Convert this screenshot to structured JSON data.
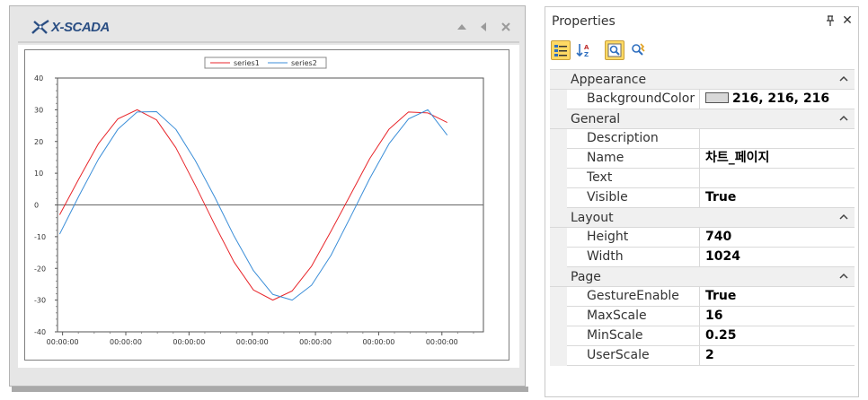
{
  "panel": {
    "logo_text": "X-SCADA",
    "controls": [
      "up-arrow-icon",
      "left-arrow-icon",
      "close-icon"
    ]
  },
  "chart_data": {
    "type": "line",
    "legend": [
      "series1",
      "series2"
    ],
    "legend_position": "top-center",
    "ylim": [
      -40,
      40
    ],
    "yticks": [
      40,
      30,
      20,
      10,
      0,
      -10,
      -20,
      -30,
      -40
    ],
    "xtick_labels": [
      "00:00:00",
      "00:00:00",
      "00:00:00",
      "00:00:00",
      "00:00:00",
      "00:00:00",
      "00:00:00"
    ],
    "grid": false,
    "zero_line": true,
    "series": [
      {
        "name": "series1",
        "color": "#e8262b",
        "x": [
          0,
          0.05,
          0.1,
          0.15,
          0.2,
          0.25,
          0.3,
          0.35,
          0.4,
          0.45,
          0.5,
          0.55,
          0.6,
          0.65,
          0.7,
          0.75,
          0.8,
          0.85,
          0.9,
          0.95,
          1.0
        ],
        "values": [
          -3.1,
          8.3,
          19.3,
          27.1,
          30.0,
          26.8,
          18.0,
          6.2,
          -6.2,
          -18.0,
          -26.8,
          -30.0,
          -27.1,
          -19.3,
          -8.3,
          3.1,
          14.6,
          23.9,
          29.3,
          29.0,
          26.0
        ]
      },
      {
        "name": "series2",
        "color": "#3b8ed8",
        "x": [
          0,
          0.05,
          0.1,
          0.15,
          0.2,
          0.25,
          0.3,
          0.35,
          0.4,
          0.45,
          0.5,
          0.55,
          0.6,
          0.65,
          0.7,
          0.75,
          0.8,
          0.85,
          0.9,
          0.95,
          1.0
        ],
        "values": [
          -9.2,
          2.9,
          14.4,
          23.8,
          29.3,
          29.4,
          23.8,
          14.0,
          2.5,
          -9.8,
          -20.7,
          -28.2,
          -30.0,
          -25.3,
          -15.9,
          -3.9,
          8.3,
          19.3,
          27.1,
          30.0,
          22.0
        ]
      }
    ]
  },
  "properties": {
    "title": "Properties",
    "toolbar": [
      "categorized-icon",
      "alphabetical-icon",
      "properties-icon",
      "events-icon"
    ],
    "categories": [
      {
        "name": "Appearance",
        "rows": [
          {
            "name": "BackgroundColor",
            "value": "216, 216, 216",
            "swatch": "#d8d8d8"
          }
        ]
      },
      {
        "name": "General",
        "rows": [
          {
            "name": "Description",
            "value": ""
          },
          {
            "name": "Name",
            "value": "차트_페이지"
          },
          {
            "name": "Text",
            "value": ""
          },
          {
            "name": "Visible",
            "value": "True"
          }
        ]
      },
      {
        "name": "Layout",
        "rows": [
          {
            "name": "Height",
            "value": "740"
          },
          {
            "name": "Width",
            "value": "1024"
          }
        ]
      },
      {
        "name": "Page",
        "rows": [
          {
            "name": "GestureEnable",
            "value": "True"
          },
          {
            "name": "MaxScale",
            "value": "16"
          },
          {
            "name": "MinScale",
            "value": "0.25"
          },
          {
            "name": "UserScale",
            "value": "2"
          }
        ]
      }
    ]
  }
}
